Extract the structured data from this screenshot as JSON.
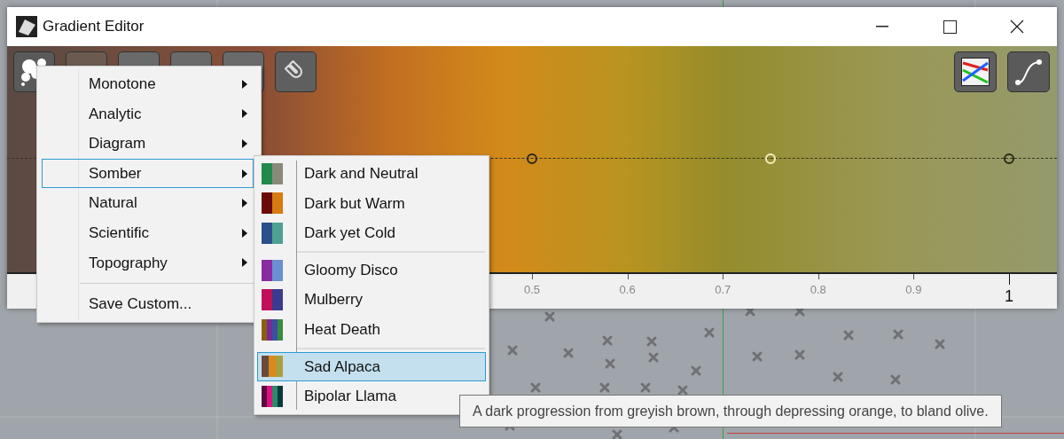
{
  "window": {
    "title": "Gradient Editor"
  },
  "stops": [
    {
      "selected": false
    },
    {
      "selected": true
    },
    {
      "selected": false
    }
  ],
  "ruler": {
    "ticks": [
      {
        "label": "0.5",
        "major": false
      },
      {
        "label": "0.6",
        "major": false
      },
      {
        "label": "0.7",
        "major": false
      },
      {
        "label": "0.8",
        "major": false
      },
      {
        "label": "0.9",
        "major": false
      },
      {
        "label": "1",
        "major": true
      }
    ]
  },
  "menu": {
    "items": [
      {
        "label": "Monotone",
        "kind": "submenu",
        "selected": false
      },
      {
        "label": "Analytic",
        "kind": "submenu",
        "selected": false
      },
      {
        "label": "Diagram",
        "kind": "submenu",
        "selected": false
      },
      {
        "label": "Somber",
        "kind": "submenu",
        "selected": true
      },
      {
        "label": "Natural",
        "kind": "submenu",
        "selected": false
      },
      {
        "label": "Scientific",
        "kind": "submenu",
        "selected": false
      },
      {
        "label": "Topography",
        "kind": "submenu",
        "selected": false
      },
      {
        "label": "Save Custom...",
        "kind": "action",
        "selected": false
      }
    ]
  },
  "submenu": {
    "groups": [
      [
        {
          "label": "Dark and Neutral",
          "swatch": [
            {
              "color": "#1f8a4a"
            },
            {
              "color": "#8a8a7a"
            }
          ],
          "selected": false
        },
        {
          "label": "Dark but Warm",
          "swatch": [
            {
              "color": "#6a0a0a"
            },
            {
              "color": "#d77a10"
            }
          ],
          "selected": false
        },
        {
          "label": "Dark yet Cold",
          "swatch": [
            {
              "color": "#2a4f8a"
            },
            {
              "color": "#4fa090"
            }
          ],
          "selected": false
        }
      ],
      [
        {
          "label": "Gloomy Disco",
          "swatch": [
            {
              "color": "#8a2aa0"
            },
            {
              "color": "#6a90d0"
            }
          ],
          "selected": false
        },
        {
          "label": "Mulberry",
          "swatch": [
            {
              "color": "#c0105a"
            },
            {
              "color": "#3a3a90"
            }
          ],
          "selected": false
        },
        {
          "label": "Heat Death",
          "swatch": [
            {
              "color": "#8a6010"
            },
            {
              "color": "#7a2a90"
            },
            {
              "color": "#3a50a0"
            },
            {
              "color": "#3a8a40"
            }
          ],
          "selected": false
        }
      ],
      [
        {
          "label": "Sad Alpaca",
          "swatch": [
            {
              "color": "#6a4a40"
            },
            {
              "color": "#d88a20"
            },
            {
              "color": "#a8a040"
            }
          ],
          "selected": true
        },
        {
          "label": "Bipolar Llama",
          "swatch": [
            {
              "color": "#5a0a40"
            },
            {
              "color": "#e01080"
            },
            {
              "color": "#2a8a6a"
            },
            {
              "color": "#0a3a3a"
            }
          ],
          "selected": false
        }
      ]
    ]
  },
  "tooltip": {
    "text": "A dark progression from greyish brown, through depressing orange, to bland olive."
  }
}
